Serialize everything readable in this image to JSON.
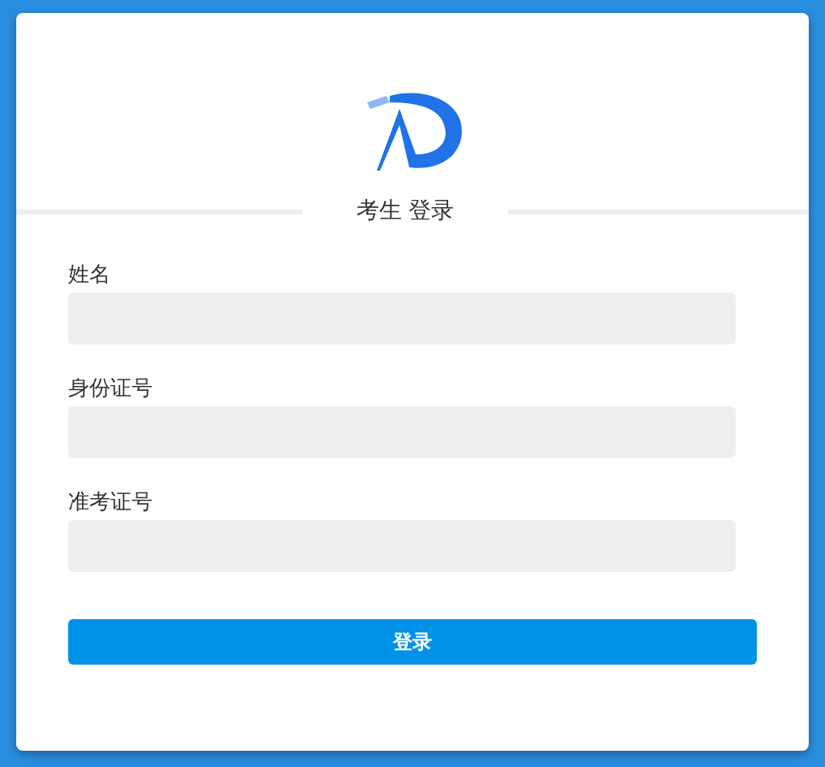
{
  "title": "考生 登录",
  "fields": [
    {
      "label": "姓名"
    },
    {
      "label": "身份证号"
    },
    {
      "label": "准考证号"
    }
  ],
  "submit": "登录"
}
